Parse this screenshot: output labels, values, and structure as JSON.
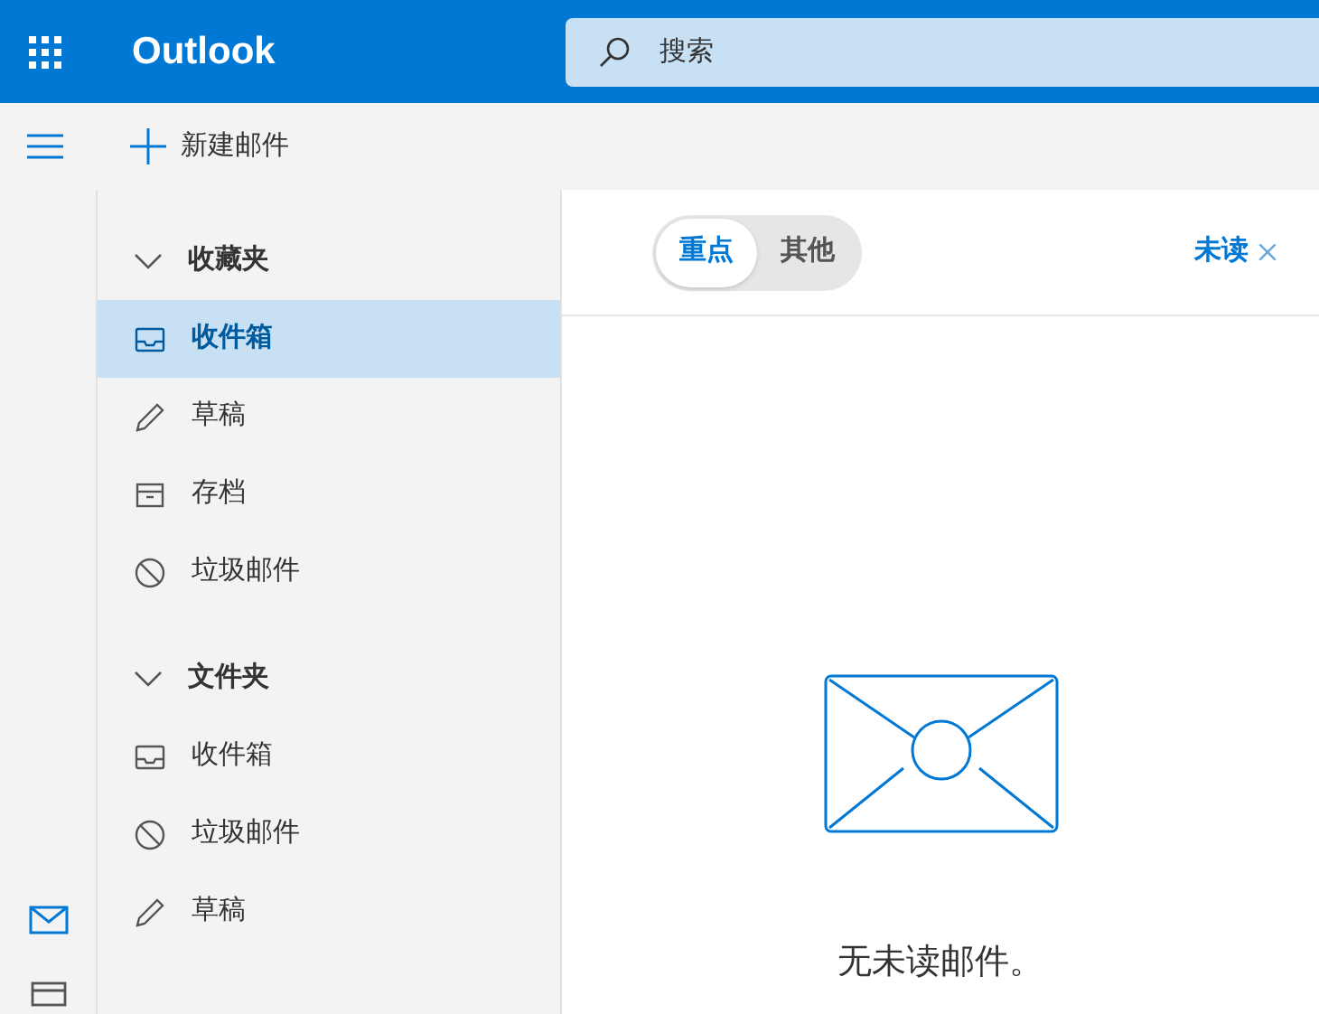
{
  "header": {
    "app_name": "Outlook",
    "search": {
      "placeholder": "搜索"
    }
  },
  "toolbar": {
    "new_mail": "新建邮件"
  },
  "folder_sections": [
    {
      "title": "收藏夹",
      "expanded": true,
      "items": [
        {
          "label": "收件箱",
          "kind": "inbox",
          "selected": true
        },
        {
          "label": "草稿",
          "kind": "drafts",
          "selected": false
        },
        {
          "label": "存档",
          "kind": "archive",
          "selected": false
        },
        {
          "label": "垃圾邮件",
          "kind": "junk",
          "selected": false
        }
      ]
    },
    {
      "title": "文件夹",
      "expanded": true,
      "items": [
        {
          "label": "收件箱",
          "kind": "inbox",
          "selected": false
        },
        {
          "label": "垃圾邮件",
          "kind": "junk",
          "selected": false
        },
        {
          "label": "草稿",
          "kind": "drafts",
          "selected": false
        }
      ]
    }
  ],
  "pivot_tabs": [
    {
      "label": "重点",
      "selected": true
    },
    {
      "label": "其他",
      "selected": false
    }
  ],
  "filter": {
    "label": "未读"
  },
  "empty_state": {
    "message": "无未读邮件。"
  }
}
